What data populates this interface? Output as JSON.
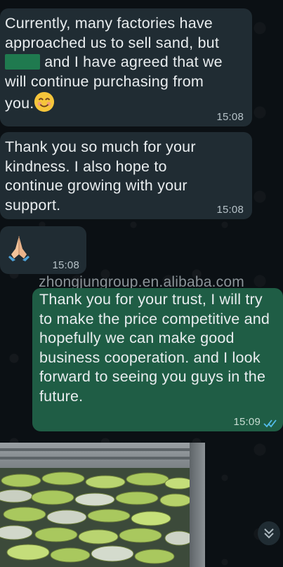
{
  "messages": [
    {
      "direction": "incoming",
      "lines": [
        "Currently, many factories have",
        "approached us to sell sand, but"
      ],
      "line3_after_redaction": "and I have agreed that we",
      "line4": "will continue purchasing from",
      "line5": "you.",
      "emoji": "smiling-face-icon",
      "time": "15:08"
    },
    {
      "direction": "incoming",
      "text": "Thank you so much for your kindness. I also hope to continue growing with your support.",
      "time": "15:08"
    },
    {
      "direction": "incoming",
      "emoji": "folded-hands-icon",
      "time": "15:08"
    },
    {
      "direction": "outgoing",
      "text": "Thank you for your trust, I will try to make the price competitive and hopefully we can make good business cooperation. and I look forward to seeing you guys in the future.",
      "time": "15:09",
      "status": "read-double-check-icon"
    }
  ],
  "watermark": "zhongjungroup.en.alibaba.com",
  "colors": {
    "incoming_bubble": "#202c33",
    "outgoing_bubble": "#1f5d45",
    "read_ticks": "#53bdeb"
  }
}
